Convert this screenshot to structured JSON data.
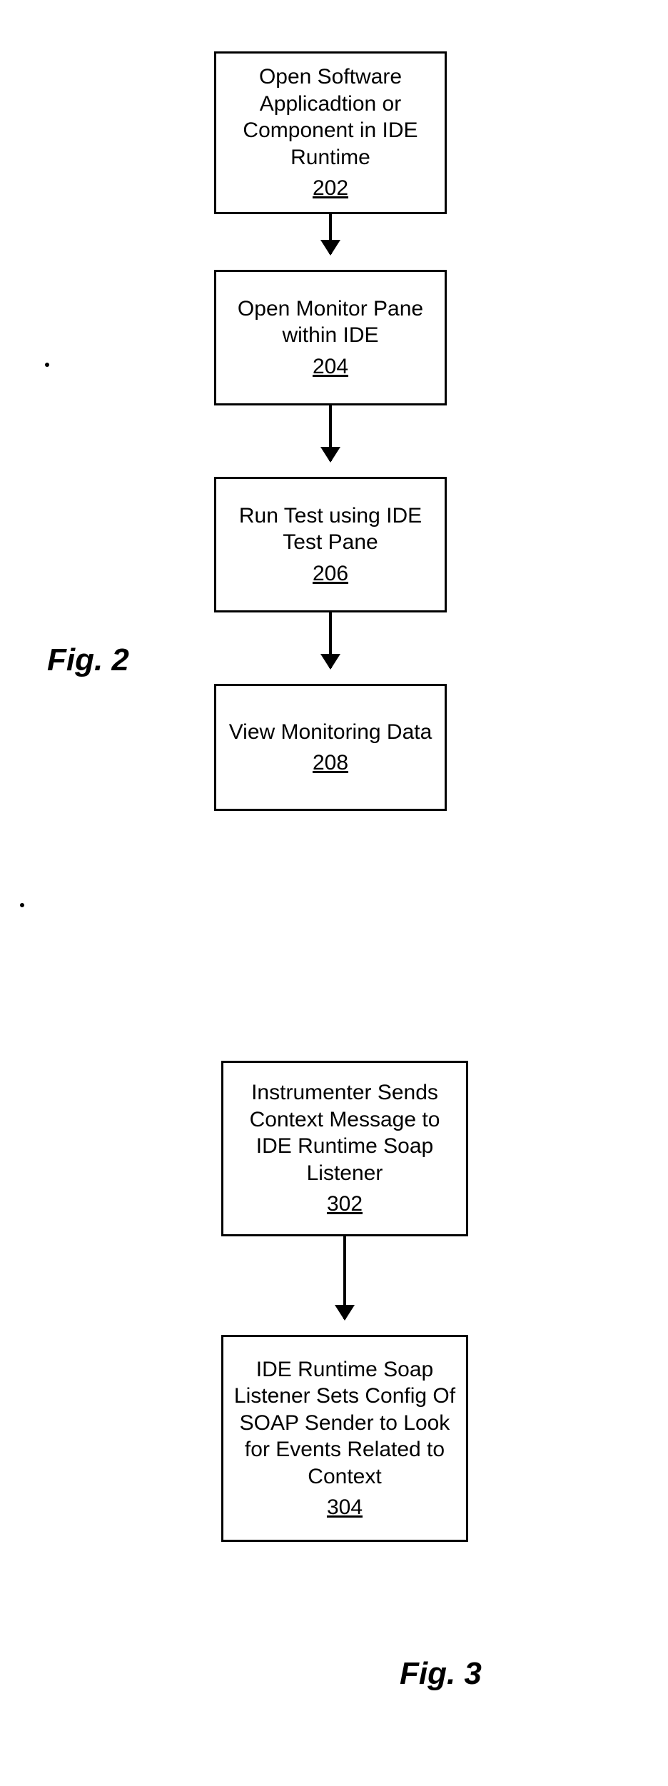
{
  "figure2": {
    "label": "Fig. 2",
    "boxes": {
      "b202": {
        "text": "Open Software Applicadtion or Component in IDE Runtime",
        "ref": "202"
      },
      "b204": {
        "text": "Open Monitor Pane within IDE",
        "ref": "204"
      },
      "b206": {
        "text": "Run Test using IDE Test Pane",
        "ref": "206"
      },
      "b208": {
        "text": "View Monitoring Data",
        "ref": "208"
      }
    }
  },
  "figure3": {
    "label": "Fig. 3",
    "boxes": {
      "b302": {
        "text": "Instrumenter Sends Context Message to IDE Runtime Soap Listener",
        "ref": "302"
      },
      "b304": {
        "text": "IDE Runtime Soap Listener Sets Config Of SOAP Sender to Look for Events Related to Context",
        "ref": "304"
      }
    }
  }
}
